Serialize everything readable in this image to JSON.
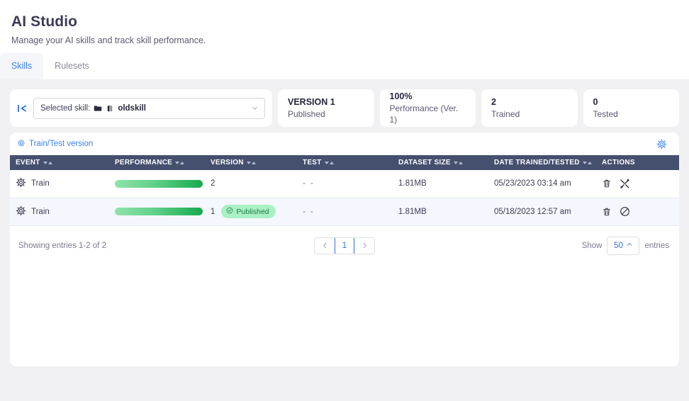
{
  "header": {
    "title": "AI Studio",
    "subtitle": "Manage your AI skills and track skill performance.",
    "tabs": [
      {
        "label": "Skills",
        "active": true
      },
      {
        "label": "Rulesets",
        "active": false
      }
    ]
  },
  "skill_selector": {
    "collapse_icon": "collapse-left-icon",
    "label": "Selected skill:",
    "folder_icon": "folder-icon",
    "brain_icon": "brain-icon",
    "value": "oldskill",
    "caret_icon": "chevron-down-icon"
  },
  "kpis": [
    {
      "value": "VERSION 1",
      "label": "Published"
    },
    {
      "value": "100%",
      "label": "Performance (Ver. 1)"
    },
    {
      "value": "2",
      "label": "Trained"
    },
    {
      "value": "0",
      "label": "Tested"
    }
  ],
  "toolbar": {
    "link_label": "Train/Test version",
    "link_icon": "gear-icon",
    "settings_icon": "gear-icon"
  },
  "table": {
    "columns": [
      {
        "label": "EVENT",
        "sortable": true
      },
      {
        "label": "PERFORMANCE",
        "sortable": true
      },
      {
        "label": "VERSION",
        "sortable": true
      },
      {
        "label": "TEST",
        "sortable": true
      },
      {
        "label": "DATASET SIZE",
        "sortable": true
      },
      {
        "label": "DATE TRAINED/TESTED",
        "sortable": true
      },
      {
        "label": "ACTIONS",
        "sortable": false
      }
    ],
    "rows": [
      {
        "event": "Train",
        "event_icon": "gear-icon",
        "performance_pct": 100,
        "version": "2",
        "published": false,
        "badge": "",
        "test": "- -",
        "dataset_size": "1.81MB",
        "date": "05/23/2023 03:14 am",
        "actions": [
          "trash-icon",
          "tools-icon"
        ]
      },
      {
        "event": "Train",
        "event_icon": "gear-icon",
        "performance_pct": 100,
        "version": "1",
        "published": true,
        "badge": "Published",
        "test": "- -",
        "dataset_size": "1.81MB",
        "date": "05/18/2023 12:57 am",
        "actions": [
          "trash-icon",
          "ban-icon"
        ]
      }
    ]
  },
  "footer": {
    "showing_text": "Showing entries 1-2 of 2",
    "prev_icon": "chevron-left-icon",
    "next_icon": "chevron-right-icon",
    "current_page": "1",
    "show_label": "Show",
    "entries_value": "50",
    "entries_caret": "chevron-up-icon",
    "entries_label": "entries"
  },
  "colors": {
    "accent_blue": "#3b82f6",
    "header_dark": "#454f6e",
    "bar_green_start": "#8fe3ab",
    "bar_green_end": "#17a94c",
    "badge_bg": "#aaf0c4",
    "badge_text": "#1d7a42",
    "page_bg": "#f1f1f3"
  }
}
